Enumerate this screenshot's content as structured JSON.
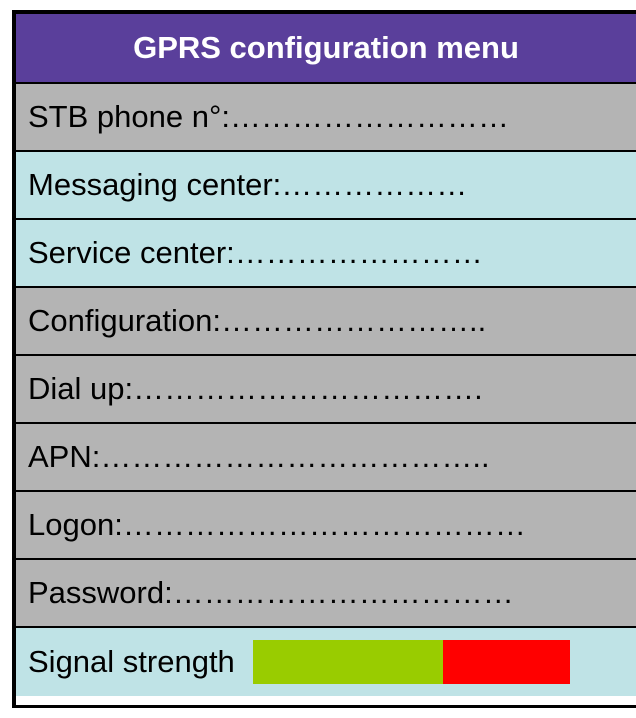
{
  "menu": {
    "title": "GPRS configuration menu",
    "colors": {
      "title_bg": "#5a3f9b",
      "gray_row": "#b4b4b4",
      "blue_row": "#bfe3e6",
      "signal_good": "#99cc00",
      "signal_bad": "#ff0000"
    },
    "rows": [
      {
        "label": "STB phone n°:………………………",
        "style": "gray"
      },
      {
        "label": "Messaging center:………………",
        "style": "blue"
      },
      {
        "label": "Service center:……………………",
        "style": "blue"
      },
      {
        "label": "Configuration:……………………..",
        "style": "gray"
      },
      {
        "label": "Dial up:…………………………….",
        "style": "gray"
      },
      {
        "label": "APN:………………………………..",
        "style": "gray"
      },
      {
        "label": "Logon:…………………………………",
        "style": "gray"
      },
      {
        "label": "Password:……………………………",
        "style": "gray"
      }
    ],
    "signal": {
      "label": "Signal strength",
      "level": 0.6
    }
  }
}
